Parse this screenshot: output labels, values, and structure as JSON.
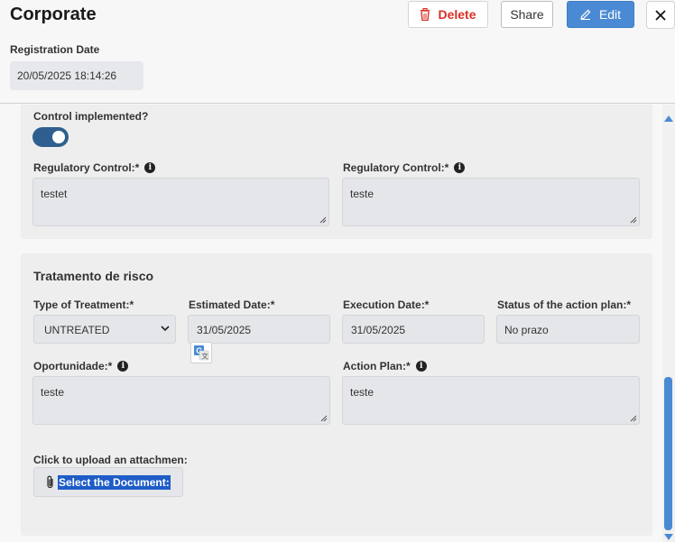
{
  "header": {
    "title": "Corporate",
    "delete_label": "Delete",
    "share_label": "Share",
    "edit_label": "Edit",
    "registration_label": "Registration Date",
    "registration_value": "20/05/2025 18:14:26"
  },
  "controls": {
    "partial_label": "Control implemented?",
    "toggle_on": true,
    "regulatory_left_label": "Regulatory Control:*",
    "regulatory_left_value": "testet",
    "regulatory_right_label": "Regulatory Control:*",
    "regulatory_right_value": "teste"
  },
  "treatment": {
    "section_title": "Tratamento de risco",
    "type_label": "Type of Treatment:*",
    "type_value": "UNTREATED",
    "estimated_label": "Estimated Date:*",
    "estimated_value": "31/05/2025",
    "execution_label": "Execution Date:*",
    "execution_value": "31/05/2025",
    "status_label": "Status of the action plan:*",
    "status_value": "No prazo",
    "opportunity_label": "Oportunidade:*",
    "opportunity_value": "teste",
    "action_label": "Action Plan:*",
    "action_value": "teste",
    "upload_label": "Click to upload an attachmen:",
    "upload_button": "Select the Document:"
  },
  "colors": {
    "accent": "#4a8ad4",
    "delete": "#d93025",
    "toggle": "#2f5f8f",
    "selection": "#1e5cc8"
  },
  "icons": {
    "delete": "trash-icon",
    "edit": "pencil-icon",
    "close": "close-icon",
    "info": "info-icon",
    "attach": "paperclip-icon",
    "translate": "translate-icon"
  }
}
